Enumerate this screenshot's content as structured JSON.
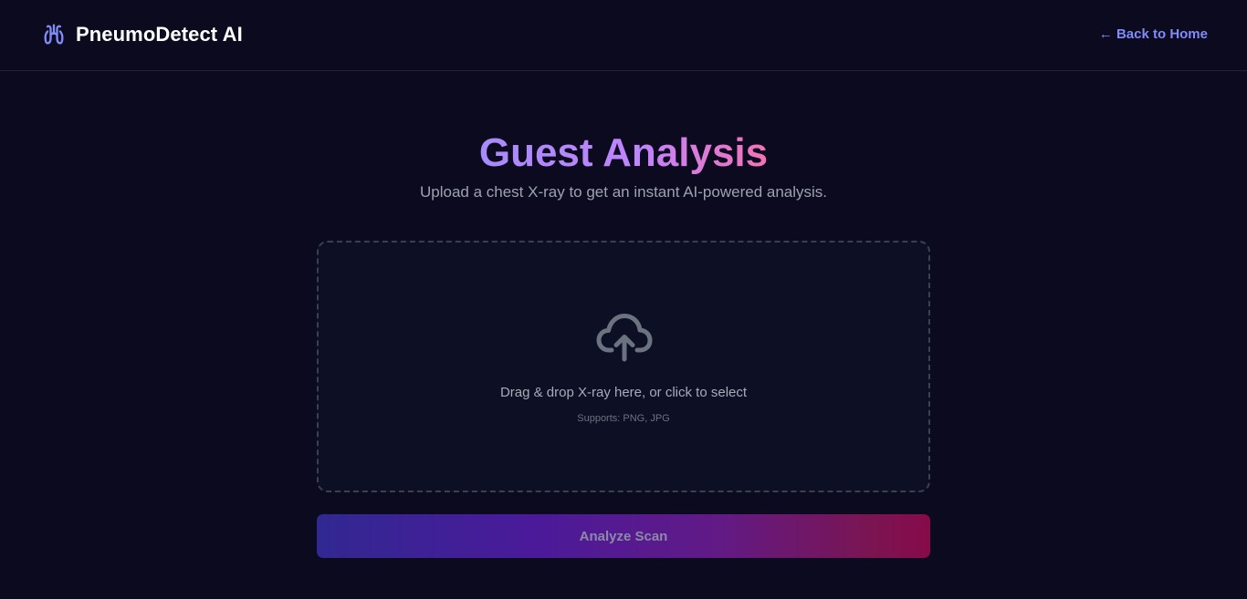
{
  "header": {
    "brand_name": "PneumoDetect AI",
    "brand_icon": "lungs-icon",
    "back_link": "← Back to Home"
  },
  "main": {
    "title": "Guest Analysis",
    "subtitle": "Upload a chest X-ray to get an instant AI-powered analysis."
  },
  "dropzone": {
    "icon": "cloud-upload-icon",
    "prompt": "Drag & drop X-ray here, or click to select",
    "formats": "Supports: PNG, JPG"
  },
  "actions": {
    "analyze_label": "Analyze Scan"
  },
  "colors": {
    "background": "#0b0a1e",
    "accent": "#818cf8",
    "title_gradient_start": "#a78bfa",
    "title_gradient_end": "#f472b6"
  }
}
